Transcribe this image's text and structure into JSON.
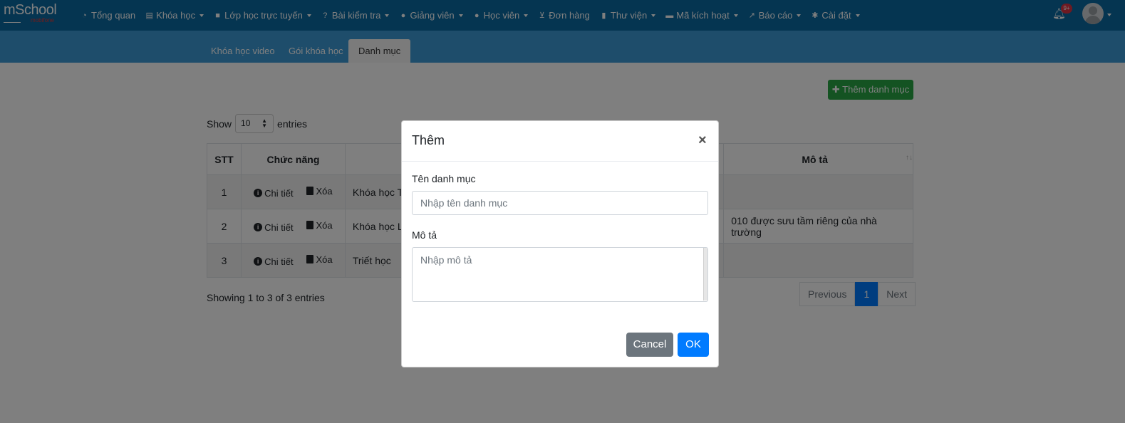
{
  "header": {
    "logo_text": "mSchool",
    "logo_sub": "mobifone",
    "nav": [
      {
        "label": "Tổng quan",
        "icon": "dashboard-icon",
        "caret": false
      },
      {
        "label": "Khóa học",
        "icon": "list-icon",
        "caret": true
      },
      {
        "label": "Lớp học trực tuyến",
        "icon": "video-icon",
        "caret": true
      },
      {
        "label": "Bài kiểm tra",
        "icon": "question-circle-icon",
        "caret": true
      },
      {
        "label": "Giảng viên",
        "icon": "users-icon",
        "caret": true
      },
      {
        "label": "Học viên",
        "icon": "user-icon",
        "caret": true
      },
      {
        "label": "Đơn hàng",
        "icon": "cart-icon",
        "caret": false
      },
      {
        "label": "Thư viện",
        "icon": "book-icon",
        "caret": true
      },
      {
        "label": "Mã kích hoạt",
        "icon": "credit-card-icon",
        "caret": true
      },
      {
        "label": "Báo cáo",
        "icon": "chart-icon",
        "caret": true
      },
      {
        "label": "Cài đặt",
        "icon": "cogs-icon",
        "caret": true
      }
    ],
    "notification_badge": "9+"
  },
  "tabs": [
    {
      "label": "Khóa học video",
      "active": false
    },
    {
      "label": "Gói khóa học",
      "active": false
    },
    {
      "label": "Danh mục",
      "active": true
    }
  ],
  "main": {
    "add_button": "Thêm danh mục",
    "show_label": "Show",
    "entries_value": "10",
    "entries_label": "entries",
    "table": {
      "headers": [
        "STT",
        "Chức năng",
        "",
        "Mô tả"
      ],
      "rows": [
        {
          "stt": "1",
          "name": "Khóa học T",
          "desc": ""
        },
        {
          "stt": "2",
          "name": "Khóa học L",
          "desc": "010 được sưu tầm riêng của nhà trường"
        },
        {
          "stt": "3",
          "name": "Triết học",
          "desc": ""
        }
      ],
      "action_detail": "Chi tiết",
      "action_delete": "Xóa"
    },
    "info": "Showing 1 to 3 of 3 entries",
    "pagination": {
      "previous": "Previous",
      "page": "1",
      "next": "Next"
    }
  },
  "modal": {
    "title": "Thêm",
    "close": "×",
    "name_label": "Tên danh mục",
    "name_placeholder": "Nhập tên danh mục",
    "desc_label": "Mô tả",
    "desc_placeholder": "Nhập mô tả",
    "cancel": "Cancel",
    "ok": "OK"
  }
}
